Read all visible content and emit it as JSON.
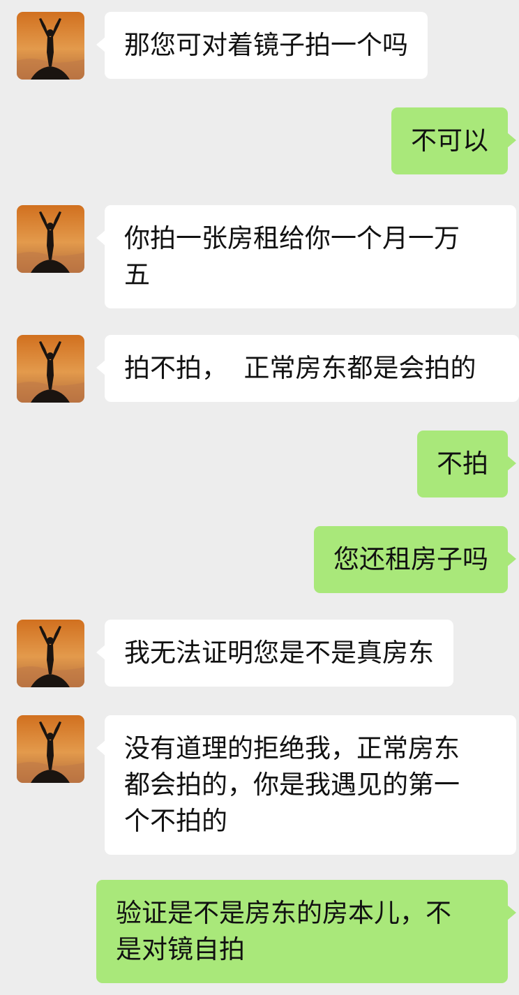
{
  "chat": {
    "messages": [
      {
        "side": "in",
        "text": "那您可对着镜子拍一个吗",
        "avatar_icon": "person-arms-raised-sunset-icon"
      },
      {
        "side": "out",
        "text": "不可以"
      },
      {
        "side": "in",
        "text": "你拍一张房租给你一个月一万\n五",
        "avatar_icon": "person-arms-raised-sunset-icon"
      },
      {
        "side": "in",
        "text": "拍不拍，  正常房东都是会拍的",
        "avatar_icon": "person-arms-raised-sunset-icon"
      },
      {
        "side": "out",
        "text": "不拍"
      },
      {
        "side": "out",
        "text": "您还租房子吗"
      },
      {
        "side": "in",
        "text": "我无法证明您是不是真房东",
        "avatar_icon": "person-arms-raised-sunset-icon"
      },
      {
        "side": "in",
        "text": "没有道理的拒绝我，正常房东\n都会拍的，你是我遇见的第一\n个不拍的",
        "avatar_icon": "person-arms-raised-sunset-icon"
      },
      {
        "side": "out",
        "text": "验证是不是房东的房本儿，不\n是对镜自拍"
      }
    ]
  },
  "colors": {
    "background": "#ededed",
    "incoming_bubble": "#ffffff",
    "outgoing_bubble": "#a9e87a",
    "text": "#111111"
  }
}
